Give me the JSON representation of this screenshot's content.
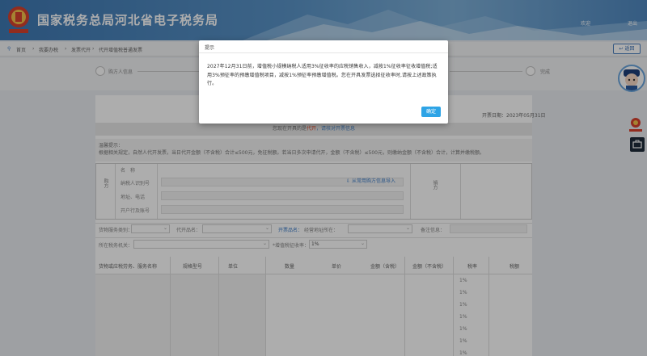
{
  "header": {
    "site_title": "国家税务总局河北省电子税务局",
    "user_label": "欢迎",
    "logout_label": "退出"
  },
  "breadcrumb": {
    "items": [
      "首页",
      "我要办税",
      "发票代开",
      "代开增值税普通发票"
    ],
    "back_label": "返回"
  },
  "steps": {
    "first_label": "购方人信息",
    "last_label": "完成"
  },
  "form": {
    "deadline": "开票日期：2023年05月31日",
    "notice_prefix": "您现在开具的是",
    "notice_highlight": "代开",
    "notice_suffix": "，请核对开票信息",
    "tips_title": "温馨提示：",
    "tips_text": "根据相关规定，自然人代开发票，当日代开金额（不含税）合计≤500元，免征税额。若当日多次申请代开，金额（不含税）≤500元，则缴纳金额（不含税）合计，计算并缴税额。",
    "buyer_side_label": "购方",
    "buyer_fields": [
      "名　称",
      "纳税人识别号",
      "地址、电话",
      "开户行及账号"
    ],
    "import_label": "从常用购方信息导入",
    "seller_side_label": "销方",
    "row1": [
      "货物服务类别：",
      "代开品名：",
      "开票品名：",
      "经营地址所在：",
      "备注信息："
    ],
    "row2_labels": [
      "所在税务机关：",
      "*增值税征收率："
    ],
    "rate_value": "1%",
    "table_headers": [
      "货物或应税劳务、服务名称",
      "规格型号",
      "单位",
      "数量",
      "单价",
      "金额（含税）",
      "金额（不含税）",
      "税率",
      "税额"
    ],
    "rates": [
      "1%",
      "1%",
      "1%",
      "1%",
      "1%",
      "1%",
      "1%"
    ]
  },
  "dialog": {
    "title": "提示",
    "body": "2027年12月31日前，增值税小规模纳税人适用3%征收率的应税销售收入，减按1%征收率征收增值税;适用3%预征率的预缴增值税项目，减按1%预征率预缴增值税。您在开具发票选择征收率时,请按上述政策执行。",
    "ok_label": "确定"
  },
  "colors": {
    "header_blue": "#4f88c0",
    "primary_button": "#2ea4e6",
    "highlight_red": "#e14a2c"
  }
}
